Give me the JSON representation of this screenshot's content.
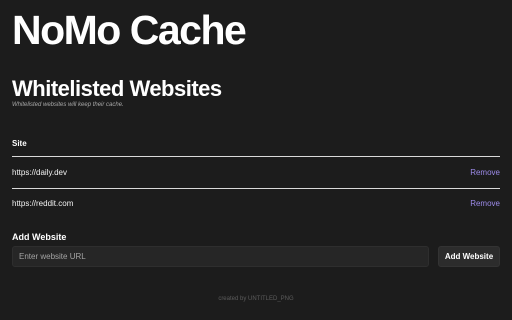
{
  "app": {
    "title": "NoMo Cache"
  },
  "whitelist": {
    "title": "Whitelisted Websites",
    "subtitle": "Whitelisted websites will keep their cache.",
    "column_header": "Site",
    "rows": [
      {
        "site": "https://daily.dev",
        "action": "Remove"
      },
      {
        "site": "https://reddit.com",
        "action": "Remove"
      }
    ]
  },
  "add_website": {
    "label": "Add Website",
    "input_value": "",
    "input_placeholder": "Enter website URL",
    "button_label": "Add Website"
  },
  "footer": {
    "text": "created by UNTITLED_PNG"
  },
  "colors": {
    "background": "#1c1c1c",
    "text": "#ffffff",
    "link": "#9d8bea",
    "divider": "#d9d9d9",
    "input_background": "#262626"
  }
}
